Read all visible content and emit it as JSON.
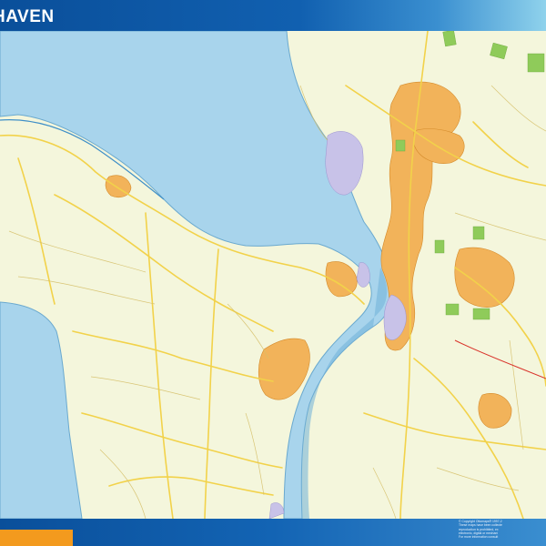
{
  "header": {
    "title": "HAVEN"
  },
  "footer": {
    "copyright_lines": [
      "© Copyright Ottomaps® 1997-2",
      "These maps have been collecte",
      "reproduction is prohibited, ex",
      "electronic, digital or mechani",
      "For more information consult"
    ]
  },
  "colors": {
    "header_blue": "#0a4f9a",
    "header_light": "#8fd2ec",
    "footer_accent": "#f39a1e",
    "water": "#a8d4ec",
    "land": "#f4f6dc",
    "urban": "#f2b35a",
    "industrial": "#c8c2e8",
    "parks": "#8fcb5a",
    "roads": "#f2d24a"
  }
}
